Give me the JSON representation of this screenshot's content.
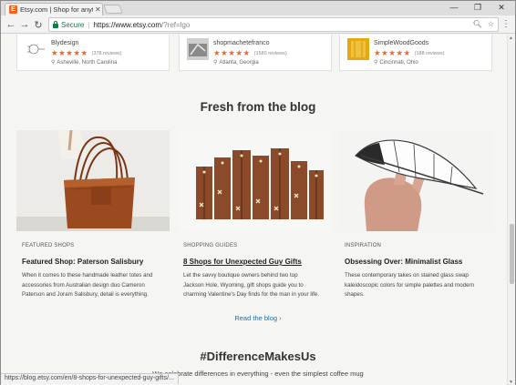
{
  "browser": {
    "tab_title": "Etsy.com | Shop for anyth",
    "tab_close": "✕",
    "favicon_letter": "E",
    "secure_label": "Secure",
    "url_main": "https://www.etsy.com",
    "url_rest": "/?ref=lgo",
    "win_minimize": "—",
    "win_maximize": "❐",
    "win_close": "✕",
    "status_url": "https://blog.etsy.com/en/8-shops-for-unexpected-guy-gifts/..."
  },
  "shops": [
    {
      "name": "Blydesign",
      "stars": "★★★★★",
      "reviews": "(378 reviews)",
      "location": "Asheville, North Carolina"
    },
    {
      "name": "shopmachetefranco",
      "stars": "★★★★★",
      "reviews": "(1580 reviews)",
      "location": "Atlanta, Georgia"
    },
    {
      "name": "SimpleWoodGoods",
      "stars": "★★★★★",
      "reviews": "(188 reviews)",
      "location": "Cincinnati, Ohio"
    }
  ],
  "blog": {
    "heading": "Fresh from the blog",
    "posts": [
      {
        "category": "FEATURED SHOPS",
        "title": "Featured Shop: Paterson Salisbury",
        "description": [
          "When it comes to these handmade leather totes and",
          "accessories from Australian design duo Cameron",
          "Paterson and Joram Salisbury, detail is everything."
        ]
      },
      {
        "category": "SHOPPING GUIDES",
        "title": "8 Shops for Unexpected Guy Gifts",
        "description": [
          "Let the savvy boutique owners behind two top",
          "Jackson Hole, Wyoming, gift shops guide you to",
          "charming Valentine's Day finds for the man in your life."
        ]
      },
      {
        "category": "INSPIRATION",
        "title": "Obsessing Over: Minimalist Glass",
        "description": [
          "These contemporary takes on stained glass swap",
          "kaleidoscopic colors for simple palettes and modern",
          "shapes."
        ]
      }
    ],
    "read_more": "Read the blog ›"
  },
  "difference": {
    "heading": "#DifferenceMakesUs",
    "subtext": "We celebrate differences in everything - even the simplest coffee mug"
  },
  "colors": {
    "etsy_orange": "#f1641e",
    "link_blue": "#1f6fa8",
    "secure_green": "#0b8043"
  }
}
